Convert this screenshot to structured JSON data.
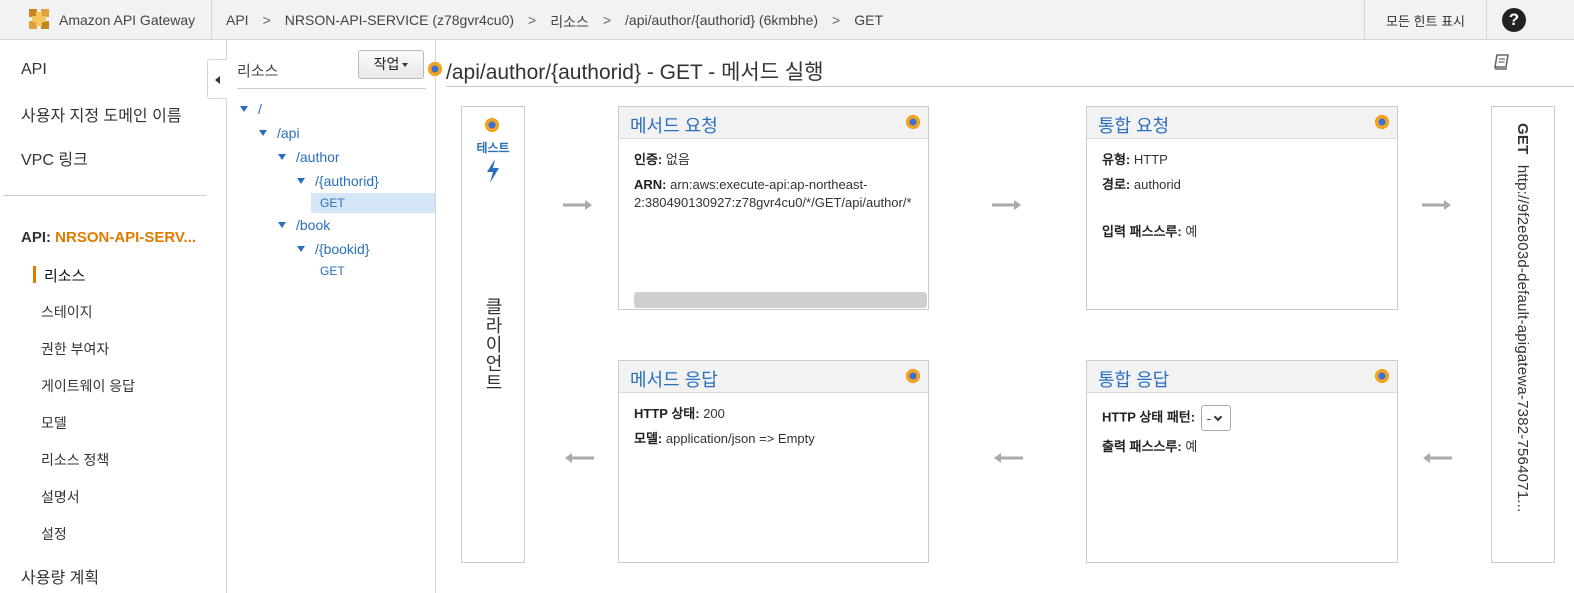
{
  "topbar": {
    "app_name": "Amazon API Gateway",
    "breadcrumbs": [
      "API",
      "NRSON-API-SERVICE (z78gvr4cu0)",
      "리소스",
      "/api/author/{authorid} (6kmbhe)",
      "GET"
    ],
    "hints_label": "모든 힌트 표시",
    "help_label": "?"
  },
  "leftnav": {
    "top_items": [
      "API",
      "사용자 지정 도메인 이름",
      "VPC 링크"
    ],
    "api_prefix": "API: ",
    "api_name": "NRSON-API-SERV...",
    "sub_items": [
      "리소스",
      "스테이지",
      "권한 부여자",
      "게이트웨이 응답",
      "모델",
      "리소스 정책",
      "설명서",
      "설정"
    ],
    "active_item": "리소스",
    "bottom_item": "사용량 계획"
  },
  "tree": {
    "title": "리소스",
    "action_label": "작업",
    "nodes": [
      "/",
      "/api",
      "/author",
      "/{authorid}",
      "GET",
      "/book",
      "/{bookid}",
      "GET"
    ]
  },
  "main": {
    "title": "/api/author/{authorid} - GET - 메서드 실행",
    "client": {
      "test_label": "테스트",
      "label": "클라이언트"
    },
    "method_request": {
      "title": "메서드 요청",
      "auth_key": "인증:",
      "auth_val": "없음",
      "arn_key": "ARN:",
      "arn_val_1": "arn:aws:execute-api:ap-northeast-",
      "arn_val_2": "2:380490130927:z78gvr4cu0/*/GET/api/author/*"
    },
    "integration_request": {
      "title": "통합 요청",
      "type_key": "유형:",
      "type_val": "HTTP",
      "path_key": "경로:",
      "path_val": "authorid",
      "passthrough_key": "입력 패스스루:",
      "passthrough_val": "예"
    },
    "method_response": {
      "title": "메서드 응답",
      "status_key": "HTTP 상태:",
      "status_val": "200",
      "model_key": "모델:",
      "model_val": "application/json => Empty"
    },
    "integration_response": {
      "title": "통합 응답",
      "pattern_key": "HTTP 상태 패턴:",
      "pattern_val": "-",
      "passthrough_key": "출력 패스스루:",
      "passthrough_val": "예"
    },
    "backend": {
      "method": "GET",
      "url": "http://9f2e803d-default-apigatewa-7382-7564071..."
    }
  },
  "colors": {
    "accent": "#e07b00",
    "link": "#2a6fbd",
    "dot": "#f5a623"
  }
}
